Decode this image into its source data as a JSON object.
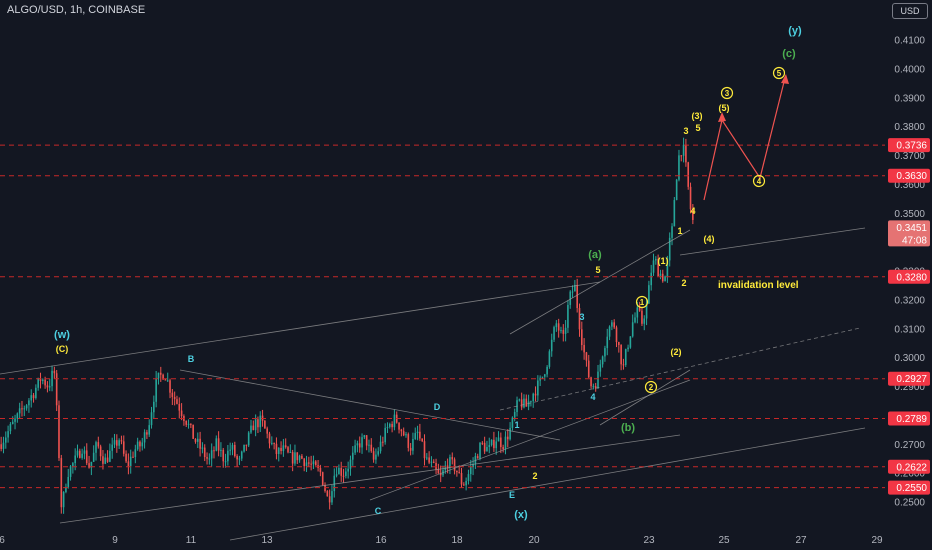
{
  "header": {
    "title": "ALGO/USD, 1h, COINBASE",
    "currency_button": "USD"
  },
  "colors": {
    "background": "#131722",
    "bull": "#26a69a",
    "bear": "#ef5350",
    "grid_text": "#b2b5be",
    "level_line": "#c62828",
    "label_red": "#e53935",
    "price_tag": "#f23645",
    "wave_cyan": "#4dd0e1",
    "wave_yellow": "#ffeb3b",
    "wave_green": "#4caf50",
    "trend_line": "#9e9e9e"
  },
  "chart_data": {
    "type": "candlestick",
    "symbol": "ALGO/USD",
    "interval": "1h",
    "exchange": "COINBASE",
    "x_axis_ticks": [
      "6",
      "9",
      "11",
      "13",
      "16",
      "18",
      "20",
      "23",
      "25",
      "27",
      "29"
    ],
    "y_axis_ticks": [
      "0.2500",
      "0.2600",
      "0.2700",
      "0.2800",
      "0.2900",
      "0.3000",
      "0.3100",
      "0.3200",
      "0.3300",
      "0.3400",
      "0.3500",
      "0.3600",
      "0.3700",
      "0.3800",
      "0.3900",
      "0.4000",
      "0.4100"
    ],
    "ylim": [
      0.2445,
      0.4175
    ],
    "price_levels": [
      {
        "value": 0.3736,
        "label": "0.3736"
      },
      {
        "value": 0.363,
        "label": "0.3630"
      },
      {
        "value": 0.328,
        "label": "0.3280"
      },
      {
        "value": 0.2927,
        "label": "0.2927"
      },
      {
        "value": 0.2789,
        "label": "0.2789"
      },
      {
        "value": 0.2622,
        "label": "0.2622"
      },
      {
        "value": 0.255,
        "label": "0.2550"
      }
    ],
    "current_price": {
      "value": 0.3451,
      "label": "0.3451",
      "countdown": "47:08"
    },
    "annotation": "invalidation level",
    "wave_labels": {
      "cyan": [
        "(w)",
        "B",
        "C",
        "D",
        "E",
        "(x)",
        "(y)",
        "1",
        "2",
        "3",
        "4",
        "5"
      ],
      "yellow": [
        "(C)",
        "(1)",
        "(2)",
        "(3)",
        "(4)",
        "(5)",
        "1",
        "2",
        "3",
        "4",
        "5"
      ],
      "yellow_circled": [
        "1",
        "2",
        "3",
        "4",
        "5"
      ],
      "green": [
        "(a)",
        "(b)",
        "(c)"
      ]
    }
  }
}
